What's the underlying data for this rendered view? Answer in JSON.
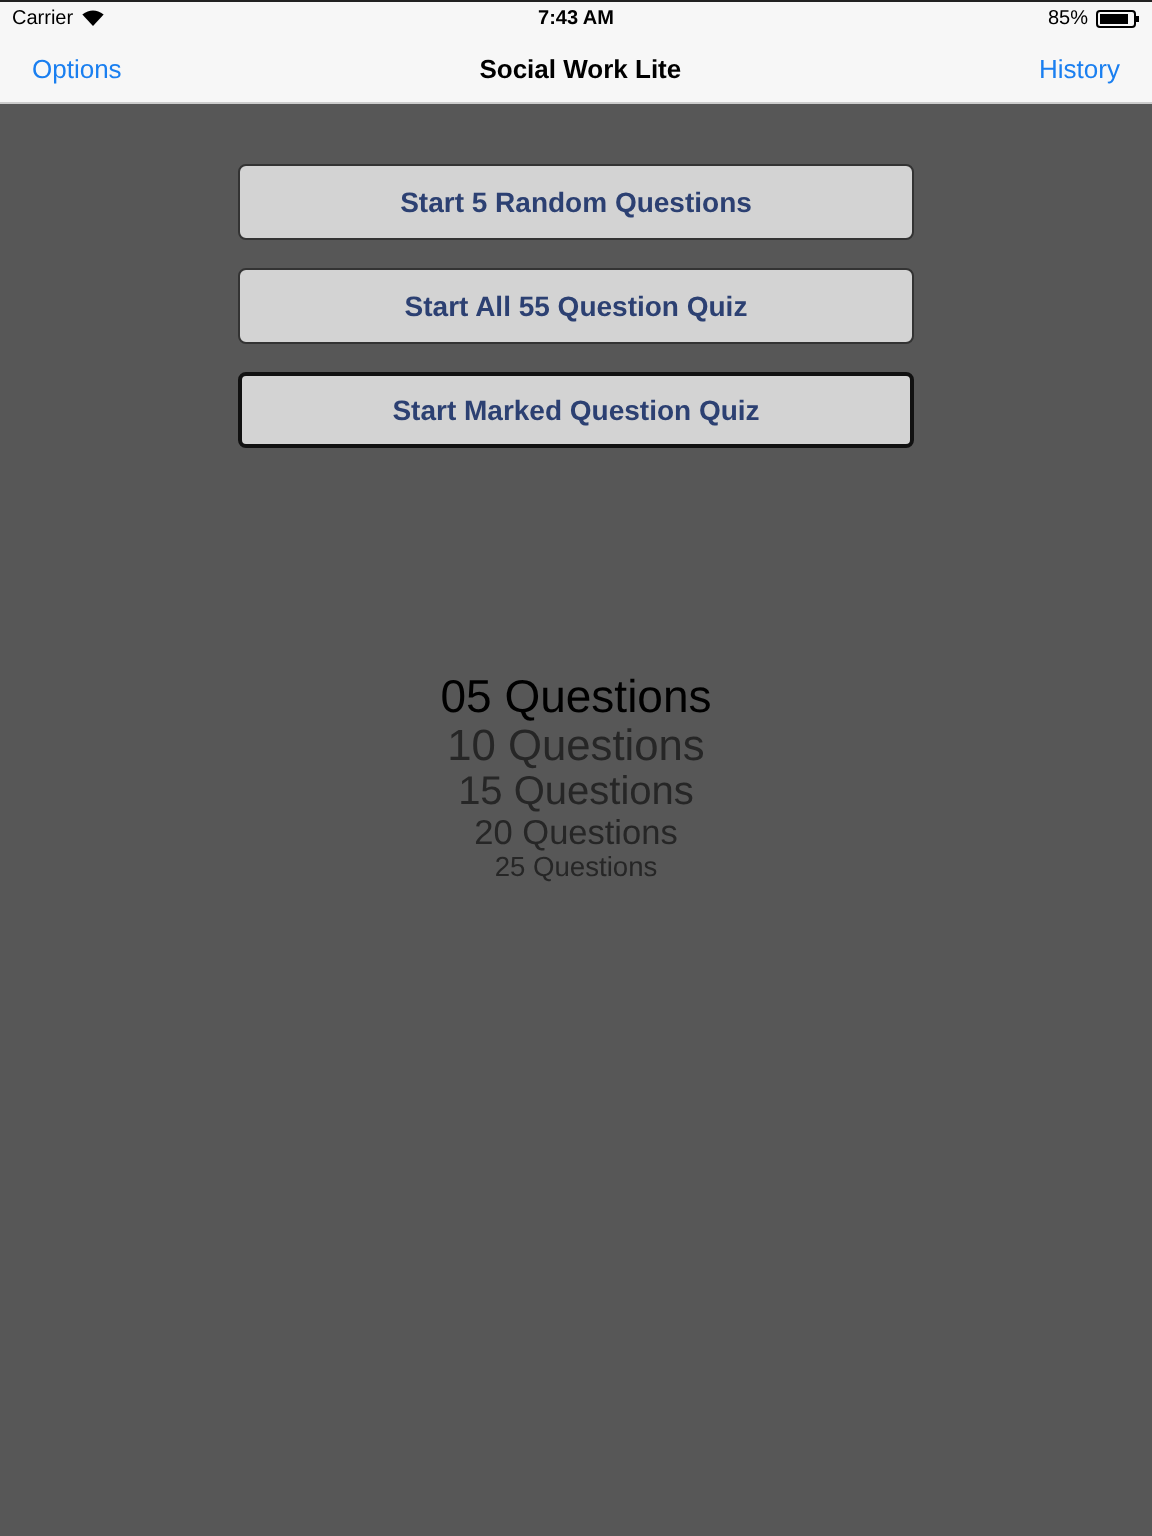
{
  "status_bar": {
    "carrier": "Carrier",
    "time": "7:43 AM",
    "battery": "85%"
  },
  "nav": {
    "left": "Options",
    "title": "Social Work Lite",
    "right": "History"
  },
  "buttons": [
    {
      "label": "Start 5 Random Questions",
      "focused": false
    },
    {
      "label": "Start All 55 Question Quiz",
      "focused": false
    },
    {
      "label": "Start Marked Question Quiz",
      "focused": true
    }
  ],
  "picker": [
    {
      "label": "05 Questions",
      "selected": true
    },
    {
      "label": "10 Questions",
      "selected": false
    },
    {
      "label": "15 Questions",
      "selected": false
    },
    {
      "label": "20 Questions",
      "selected": false
    },
    {
      "label": "25 Questions",
      "selected": false
    }
  ]
}
